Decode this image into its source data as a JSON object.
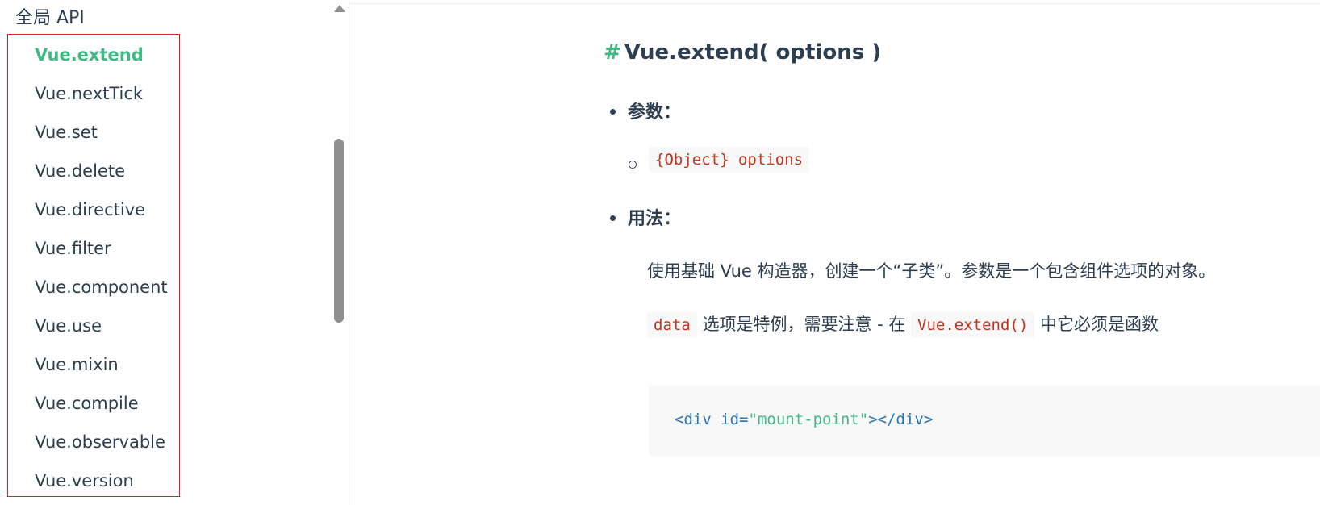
{
  "sidebar": {
    "group_title": "全局 API",
    "items": [
      {
        "label": "Vue.extend",
        "active": true
      },
      {
        "label": "Vue.nextTick"
      },
      {
        "label": "Vue.set"
      },
      {
        "label": "Vue.delete"
      },
      {
        "label": "Vue.directive"
      },
      {
        "label": "Vue.filter"
      },
      {
        "label": "Vue.component"
      },
      {
        "label": "Vue.use"
      },
      {
        "label": "Vue.mixin"
      },
      {
        "label": "Vue.compile"
      },
      {
        "label": "Vue.observable"
      },
      {
        "label": "Vue.version"
      }
    ]
  },
  "content": {
    "heading_hash": "#",
    "heading": "Vue.extend( options )",
    "params_label": "参数：",
    "param_value": "{Object} options",
    "usage_label": "用法：",
    "desc1": "使用基础 Vue 构造器，创建一个“子类”。参数是一个包含组件选项的对象。",
    "desc2_code1": "data",
    "desc2_text1": " 选项是特例，需要注意 - 在 ",
    "desc2_code2": "Vue.extend()",
    "desc2_text2": " 中它必须是函数",
    "code_prefix": "<div id=",
    "code_string": "\"mount-point\"",
    "code_suffix": "></div>"
  },
  "colors": {
    "accent": "#42b983",
    "text": "#2c3e50",
    "code_red": "#c7301a",
    "highlight_box": "#e02020"
  }
}
